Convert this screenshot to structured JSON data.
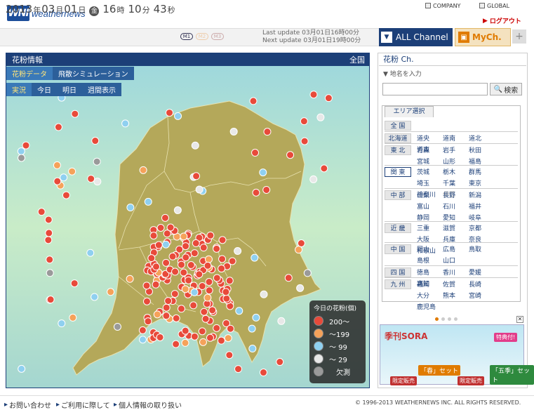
{
  "header": {
    "logo_mark": "WNI",
    "logo_text": "weathernews",
    "company": "COMPANY",
    "global": "GLOBAL",
    "logout": "ログアウト"
  },
  "datebar": {
    "year": "2013",
    "year_unit": "年",
    "month": "03",
    "month_unit": "月",
    "day": "01",
    "day_unit": "日",
    "weekday": "金",
    "hour": "16",
    "hour_unit": "時",
    "minute": "10",
    "minute_unit": "分",
    "second": "43",
    "second_unit": "秒",
    "tabs": [
      "M1",
      "M2",
      "M3"
    ],
    "last_update": "Last update  03月01日16時00分",
    "next_update": "Next update  03月01日19時00分"
  },
  "channels": {
    "all": "ALL Channel",
    "my": "MyCh.",
    "add": "+"
  },
  "map": {
    "title": "花粉情報",
    "region": "全国",
    "tabs_row1": [
      "花粉データ",
      "飛散シミュレーション"
    ],
    "tabs_row2": [
      "実況",
      "今日",
      "明日",
      "週間表示"
    ],
    "legend": {
      "title": "今日の花粉(個)",
      "rows": [
        {
          "label": "200〜",
          "color": "#e84a3a"
        },
        {
          "label": "〜199",
          "color": "#f5a25a"
        },
        {
          "label": "〜 99",
          "color": "#8fd0f0"
        },
        {
          "label": "〜 29",
          "color": "#e8e8e8"
        },
        {
          "label": "欠測",
          "color": "#9a9a9a"
        }
      ]
    }
  },
  "right": {
    "title": "花粉 Ch.",
    "place_label": "▼ 地名を入力",
    "search_placeholder": "",
    "search_button": "検索",
    "area_header": "エリア選択",
    "regions": [
      {
        "name": "全 国",
        "prefs": []
      },
      {
        "name": "北海道",
        "prefs": [
          "道央",
          "道南",
          "道北",
          "道東"
        ]
      },
      {
        "name": "東 北",
        "prefs": [
          "青森",
          "岩手",
          "秋田",
          "宮城",
          "山形",
          "福島"
        ]
      },
      {
        "name": "関 東",
        "prefs": [
          "茨城",
          "栃木",
          "群馬",
          "埼玉",
          "千葉",
          "東京",
          "神奈川",
          "伊豆"
        ]
      },
      {
        "name": "中 部",
        "prefs": [
          "山梨",
          "長野",
          "新潟",
          "富山",
          "石川",
          "福井",
          "静岡",
          "愛知",
          "岐阜"
        ]
      },
      {
        "name": "近 畿",
        "prefs": [
          "三重",
          "滋賀",
          "京都",
          "大阪",
          "兵庫",
          "奈良",
          "和歌山"
        ]
      },
      {
        "name": "中 国",
        "prefs": [
          "岡山",
          "広島",
          "鳥取",
          "島根",
          "山口"
        ]
      },
      {
        "name": "四 国",
        "prefs": [
          "徳島",
          "香川",
          "愛媛",
          "高知"
        ]
      },
      {
        "name": "九 州",
        "prefs": [
          "福岡",
          "佐賀",
          "長崎",
          "大分",
          "熊本",
          "宮崎",
          "鹿児島"
        ]
      }
    ],
    "banner": {
      "title": "季刊SORA",
      "spring": "「春」セット",
      "five": "「五季」セット",
      "bonus": "特典付!",
      "limited": "限定販売"
    }
  },
  "footer": {
    "links": [
      "お問い合わせ",
      "ご利用に際して",
      "個人情報の取り扱い"
    ],
    "copyright": "© 1996-2013 WEATHERNEWS INC. ALL RIGHTS RESERVED."
  }
}
